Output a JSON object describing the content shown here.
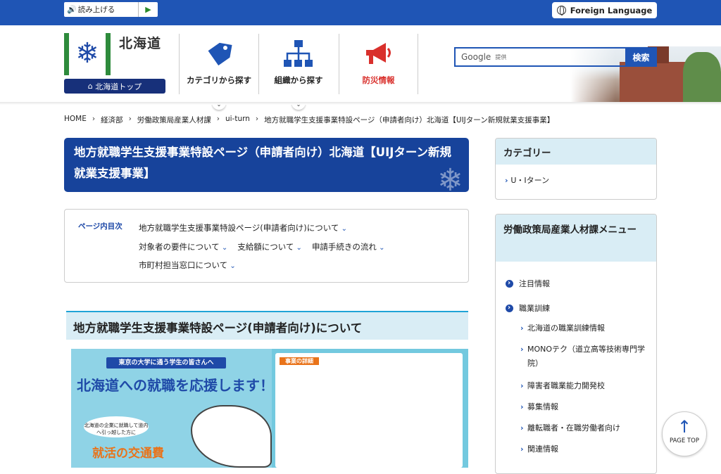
{
  "topbar": {
    "read_aloud": "読み上げる",
    "foreign_language": "Foreign Language"
  },
  "header": {
    "logo_name": "北海道",
    "top_button": "北海道トップ",
    "nav": [
      {
        "label": "カテゴリから探す",
        "icon": "tag-icon"
      },
      {
        "label": "組織から探す",
        "icon": "org-chart-icon"
      },
      {
        "label": "防災情報",
        "icon": "megaphone-icon"
      }
    ],
    "search": {
      "placeholder": "Google",
      "powered": "提供",
      "button": "検索"
    }
  },
  "breadcrumb": [
    "HOME",
    "経済部",
    "労働政策局産業人材課",
    "ui-turn",
    "地方就職学生支援事業特設ページ（申請者向け）北海道【UIJターン新規就業支援事業】"
  ],
  "page_title": "地方就職学生支援事業特設ページ（申請者向け）北海道【UIJターン新規就業支援事業】",
  "toc": {
    "title": "ページ内目次",
    "links": [
      "地方就職学生支援事業特設ページ(申請者向け)について",
      "対象者の要件について",
      "支給額について",
      "申請手続きの流れ",
      "市町村担当窓口について"
    ]
  },
  "section_title": "地方就職学生支援事業特設ページ(申請者向け)について",
  "flyer": {
    "tag": "東京の大学に通う学生の皆さんへ",
    "headline": "北海道への就職を応援します！",
    "bubble": "北海道の企業に就職して道内へ引っ越した方に",
    "orange": "就活の交通費",
    "details_title": "事業の詳細"
  },
  "sidebar": {
    "category_title": "カテゴリー",
    "category_item": "U・Iターン",
    "menu_title": "労働政策局産業人材課メニュー",
    "menu": [
      {
        "label": "注目情報",
        "level": 1
      },
      {
        "label": "職業訓練",
        "level": 1
      },
      {
        "label": "北海道の職業訓練情報",
        "level": 2
      },
      {
        "label": "MONOテク（道立高等技術専門学院）",
        "level": 2
      },
      {
        "label": "障害者職業能力開発校",
        "level": 2
      },
      {
        "label": "募集情報",
        "level": 2
      },
      {
        "label": "離転職者・在職労働者向け",
        "level": 2
      },
      {
        "label": "関連情報",
        "level": 2
      }
    ]
  },
  "page_top": "PAGE TOP",
  "colors": {
    "primary": "#1f55b5",
    "title_bg": "#17439b",
    "light_bg": "#d9edf5",
    "accent": "#e9731a"
  }
}
